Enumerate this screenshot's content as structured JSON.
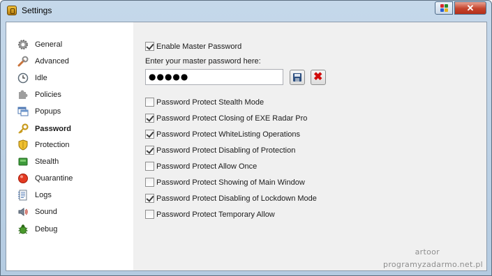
{
  "window": {
    "title": "Settings",
    "close_symbol": "✕"
  },
  "sidebar": {
    "items": [
      {
        "label": "General",
        "icon": "gear-icon",
        "active": false
      },
      {
        "label": "Advanced",
        "icon": "wrench-icon",
        "active": false
      },
      {
        "label": "Idle",
        "icon": "clock-icon",
        "active": false
      },
      {
        "label": "Policies",
        "icon": "puzzle-icon",
        "active": false
      },
      {
        "label": "Popups",
        "icon": "window-icon",
        "active": false
      },
      {
        "label": "Password",
        "icon": "key-icon",
        "active": true
      },
      {
        "label": "Protection",
        "icon": "shield-icon",
        "active": false
      },
      {
        "label": "Stealth",
        "icon": "stealth-icon",
        "active": false
      },
      {
        "label": "Quarantine",
        "icon": "quarantine-icon",
        "active": false
      },
      {
        "label": "Logs",
        "icon": "document-icon",
        "active": false
      },
      {
        "label": "Sound",
        "icon": "speaker-icon",
        "active": false
      },
      {
        "label": "Debug",
        "icon": "bug-icon",
        "active": false
      }
    ]
  },
  "password": {
    "enable_label": "Enable Master Password",
    "enable_checked": true,
    "prompt": "Enter your master password here:",
    "value": "●●●●●",
    "options": [
      {
        "label": "Password Protect Stealth Mode",
        "checked": false
      },
      {
        "label": "Password Protect Closing of EXE Radar Pro",
        "checked": true
      },
      {
        "label": "Password Protect WhiteListing Operations",
        "checked": true
      },
      {
        "label": "Password Protect Disabling of Protection",
        "checked": true
      },
      {
        "label": "Password Protect Allow Once",
        "checked": false
      },
      {
        "label": "Password Protect Showing of Main Window",
        "checked": false
      },
      {
        "label": "Password Protect Disabling of Lockdown Mode",
        "checked": true
      },
      {
        "label": "Password Protect Temporary Allow",
        "checked": false
      }
    ]
  },
  "watermark": {
    "line1": "artoor",
    "line2": "programyzadarmo.net.pl"
  }
}
